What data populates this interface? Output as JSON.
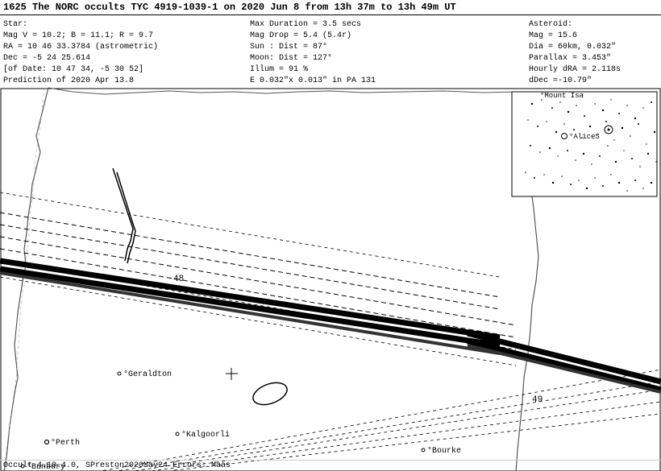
{
  "header": {
    "title": "1625  The NORC occults TYC 4919-1039-1 on 2020 Jun  8 from 13h 37m to 13h 49m UT"
  },
  "left_info": {
    "star_label": "Star:",
    "mag": "Mag V = 10.2; B = 11.1; R = 9.7",
    "ra": "RA  = 10 46 33.3784 (astrometric)",
    "dec": "Dec =  -5 24 25.614",
    "of_date": "[of Date: 10 47 34,  -5 30 52]",
    "prediction": "Prediction of 2020 Apr 13.8"
  },
  "center_info": {
    "max_duration_label": "Max Duration =",
    "max_duration_val": "3.5 secs",
    "mag_drop_label": "Mag Drop =",
    "mag_drop_val": "5.4 (5.4r)",
    "sun_label": "Sun :  Dist =",
    "sun_val": "87°",
    "moon_label": "Moon:  Dist =",
    "moon_val": "127°",
    "illum_label": "Illum =",
    "illum_val": "91 %",
    "ellipse_label": "E 0.032\"x 0.013\" in PA 131"
  },
  "right_info": {
    "asteroid_label": "Asteroid:",
    "mag": "Mag = 15.6",
    "dia": "Dia =  60km,  0.032\"",
    "parallax": "Parallax = 3.453\"",
    "hourly_ra": "Hourly dRA = 2.118s",
    "d_dec": "dDec =-10.79\""
  },
  "map_labels": {
    "geraldton": "°Geraldton",
    "perth": "°Perth",
    "bunbury": "°Bunbury",
    "kalgoorli": "°Kalgoorli",
    "bourke": "°Bourke",
    "num_48": "48",
    "num_49": "49",
    "mount_isa": "°Mount Isa",
    "alice_s": "°AliceS"
  },
  "footer": {
    "text": "Occult 4.10.4.0, SPreston2020May24 Errors: Maas"
  }
}
